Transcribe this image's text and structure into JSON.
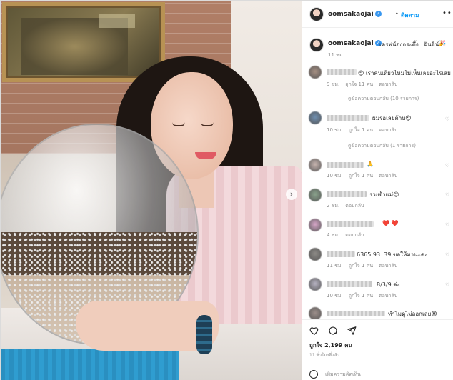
{
  "post": {
    "username": "oomsakaojai",
    "follow_label": "ติดตาม",
    "dot": "•",
    "more_icon": "more-horizontal-icon",
    "carousel_next": "›"
  },
  "caption": {
    "username": "oomsakaojai",
    "text": "เครฟน้องกระดึ้ง...ฝันดีน้า",
    "time": "11 ชม."
  },
  "comments": [
    {
      "text": "😍 เราคนเดียวไหมไม่เห็นเลยอะไรเลย",
      "time": "9 ชม.",
      "likes": "ถูกใจ 11 คน",
      "reply": "ตอบกลับ",
      "view_replies": "ดูข้อความตอบกลับ (10 รายการ)",
      "avatar_color": "#a58f82"
    },
    {
      "text": "ผมรอเลยค้าบ😍",
      "time": "10 ชม.",
      "likes": "ถูกใจ 1 คน",
      "reply": "ตอบกลับ",
      "view_replies": "ดูข้อความตอบกลับ (1 รายการ)",
      "avatar_color": "#6f8fb0"
    },
    {
      "text": "🙏",
      "time": "10 ชม.",
      "likes": "ถูกใจ 1 คน",
      "reply": "ตอบกลับ",
      "view_replies": "",
      "avatar_color": "#c8b5b0"
    },
    {
      "text": "รวยจ้าแม่😍",
      "time": "2 ชม.",
      "likes": "",
      "reply": "ตอบกลับ",
      "view_replies": "",
      "avatar_color": "#8aa38c"
    },
    {
      "text": "❤️ ❤️",
      "time": "4 ชม.",
      "likes": "",
      "reply": "ตอบกลับ",
      "view_replies": "",
      "avatar_color": "#d8a7c9"
    },
    {
      "text": "6365 93. 39 ขอให้มานะค่ะ",
      "time": "11 ชม.",
      "likes": "ถูกใจ 1 คน",
      "reply": "ตอบกลับ",
      "view_replies": "",
      "avatar_color": "#8d8a86"
    },
    {
      "text": "8/3/9 ค่ะ",
      "time": "10 ชม.",
      "likes": "ถูกใจ 1 คน",
      "reply": "ตอบกลับ",
      "view_replies": "",
      "avatar_color": "#b7b3c2"
    },
    {
      "text": "ทำไมดูไม่ออกเลย😍",
      "time": "",
      "likes": "",
      "reply": "",
      "view_replies": "",
      "avatar_color": "#9c8e8a"
    }
  ],
  "actions": {
    "like_icon": "heart-icon",
    "comment_icon": "comment-icon",
    "share_icon": "share-icon",
    "likes": "ถูกใจ 2,199 คน",
    "posted": "11 ชั่วโมงที่แล้ว",
    "add_comment_placeholder": "เพิ่มความคิดเห็น",
    "emoji_icon": "emoji-icon"
  }
}
